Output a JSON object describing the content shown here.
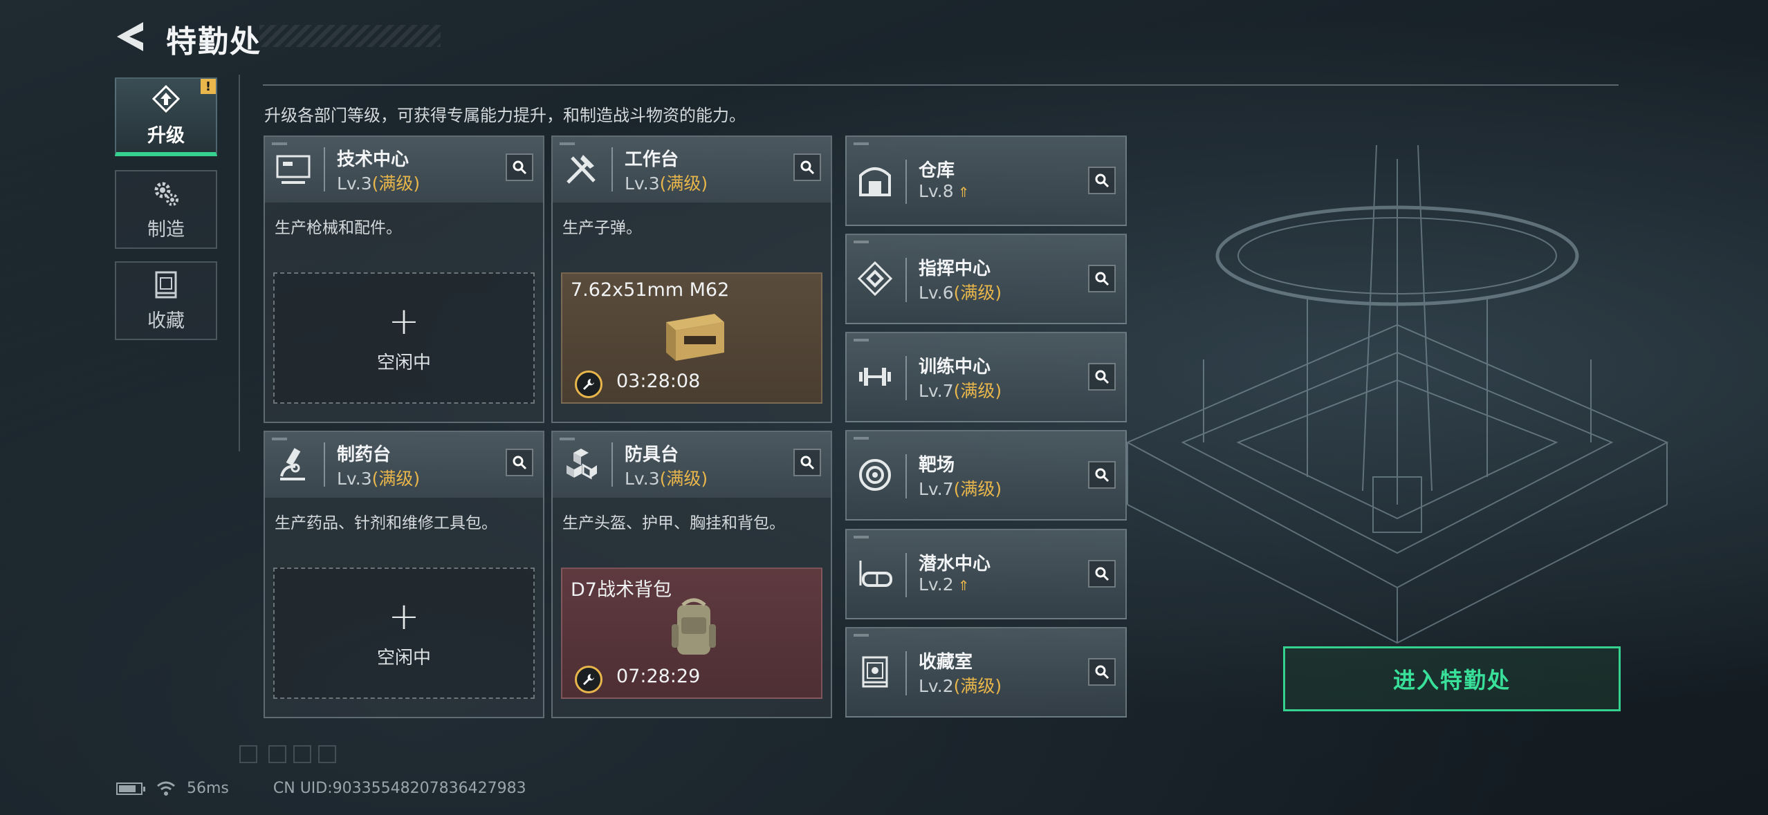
{
  "header": {
    "title": "特勤处"
  },
  "nav": [
    {
      "label": "升级",
      "icon": "upgrade-icon",
      "active": true,
      "alert": "!"
    },
    {
      "label": "制造",
      "icon": "gears-icon",
      "active": false
    },
    {
      "label": "收藏",
      "icon": "collection-icon",
      "active": false
    }
  ],
  "description": "升级各部门等级，可获得专属能力提升，和制造战斗物资的能力。",
  "workshops": [
    {
      "name": "技术中心",
      "level": "Lv.3",
      "status": "(满级)",
      "icon": "computer-icon",
      "desc": "生产枪械和配件。",
      "slot": {
        "state": "idle",
        "plus": "+",
        "label": "空闲中"
      }
    },
    {
      "name": "工作台",
      "level": "Lv.3",
      "status": "(满级)",
      "icon": "tools-icon",
      "desc": "生产子弹。",
      "slot": {
        "state": "producing",
        "item": "7.62x51mm M62",
        "timer": "03:28:08"
      }
    },
    {
      "name": "制药台",
      "level": "Lv.3",
      "status": "(满级)",
      "icon": "microscope-icon",
      "desc": "生产药品、针剂和维修工具包。",
      "slot": {
        "state": "idle",
        "plus": "+",
        "label": "空闲中"
      }
    },
    {
      "name": "防具台",
      "level": "Lv.3",
      "status": "(满级)",
      "icon": "armor-icon",
      "desc": "生产头盔、护甲、胸挂和背包。",
      "slot": {
        "state": "producing",
        "item": "D7战术背包",
        "timer": "07:28:29"
      }
    }
  ],
  "facilities": [
    {
      "name": "仓库",
      "level": "Lv.8",
      "status": "",
      "upgradable": true,
      "icon": "warehouse-icon"
    },
    {
      "name": "指挥中心",
      "level": "Lv.6",
      "status": "(满级)",
      "upgradable": false,
      "icon": "command-icon"
    },
    {
      "name": "训练中心",
      "level": "Lv.7",
      "status": "(满级)",
      "upgradable": false,
      "icon": "dumbbell-icon"
    },
    {
      "name": "靶场",
      "level": "Lv.7",
      "status": "(满级)",
      "upgradable": false,
      "icon": "target-icon"
    },
    {
      "name": "潜水中心",
      "level": "Lv.2",
      "status": "",
      "upgradable": true,
      "icon": "diving-mask-icon"
    },
    {
      "name": "收藏室",
      "level": "Lv.2",
      "status": "(满级)",
      "upgradable": false,
      "icon": "collection-room-icon"
    }
  ],
  "enter_button": "进入特勤处",
  "status_bar": {
    "ping": "56ms",
    "uid": "CN UID:903355482078364279​83"
  },
  "colors": {
    "accent": "#35d18f",
    "max_level": "#e8b64a",
    "panel": "#2c363d"
  }
}
